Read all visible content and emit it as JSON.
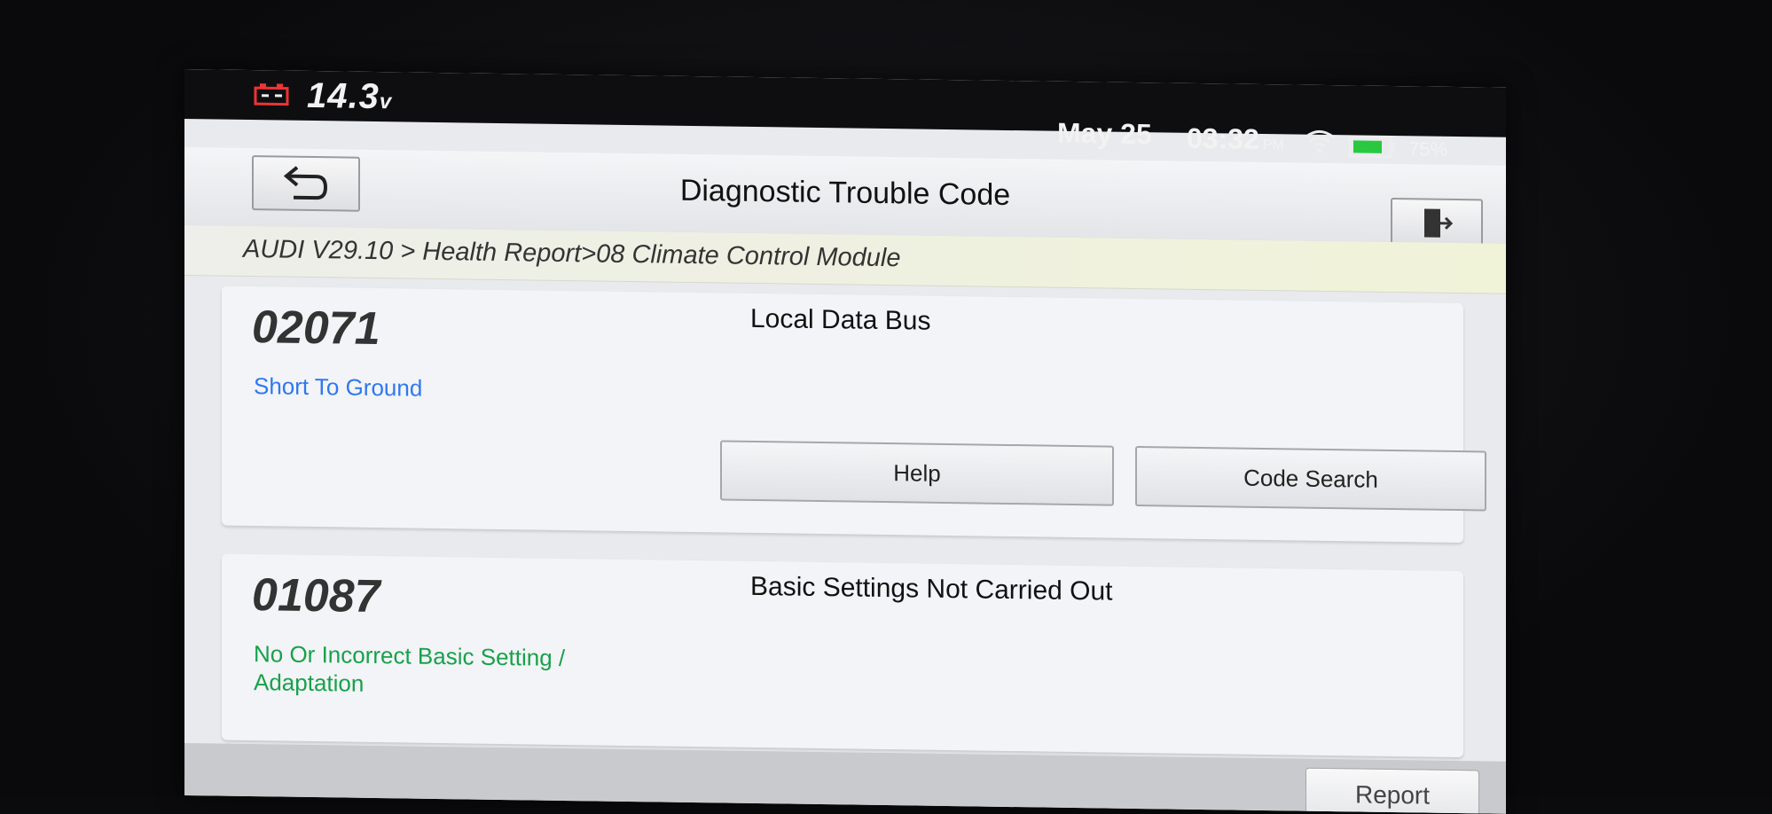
{
  "statusbar": {
    "voltage": "14.3",
    "voltage_unit": "v",
    "date": "May 25",
    "time": "03:32",
    "ampm": "PM",
    "battery_percent": "75%",
    "icons": [
      "car-battery-icon",
      "wifi-icon",
      "battery-icon"
    ]
  },
  "header": {
    "title": "Diagnostic Trouble Code",
    "back_icon": "back-arrow-icon",
    "exit_icon": "exit-door-icon"
  },
  "breadcrumb": {
    "path": "AUDI V29.10 > Health Report>08 Climate Control Module"
  },
  "dtcs": [
    {
      "code": "02071",
      "description": "Local Data Bus",
      "status": "Short To Ground",
      "status_color": "#2e78f0",
      "buttons": {
        "help": "Help",
        "code_search": "Code Search"
      }
    },
    {
      "code": "01087",
      "description": "Basic Settings Not Carried Out",
      "status": "No Or Incorrect Basic Setting / Adaptation",
      "status_color": "#18a14a"
    }
  ],
  "footer": {
    "report_label": "Report"
  },
  "colors": {
    "background": "#e9eaee",
    "statusbar": "#0e0e10",
    "breadcrumb_tint": "#f0f3d8"
  }
}
